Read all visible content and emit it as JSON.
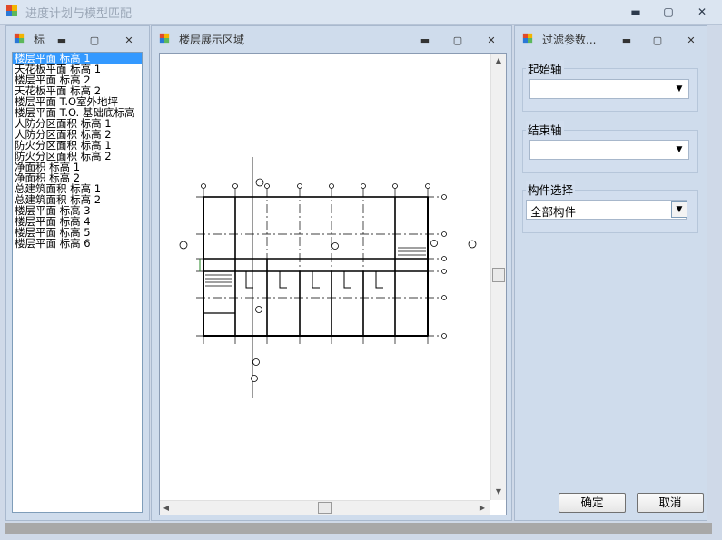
{
  "window": {
    "title": "进度计划与模型匹配",
    "min": "▬",
    "max": "▢",
    "close": "✕"
  },
  "left_panel": {
    "title": "标",
    "items": [
      "楼层平面 标高 1",
      "天花板平面 标高 1",
      "楼层平面 标高 2",
      "天花板平面 标高 2",
      "楼层平面 T.O室外地坪",
      "楼层平面 T.O. 基础底标高",
      "人防分区面积 标高 1",
      "人防分区面积 标高 2",
      "防火分区面积 标高 1",
      "防火分区面积 标高 2",
      "净面积 标高 1",
      "净面积 标高 2",
      "总建筑面积 标高 1",
      "总建筑面积 标高 2",
      "楼层平面 标高 3",
      "楼层平面 标高 4",
      "楼层平面 标高 5",
      "楼层平面 标高 6"
    ],
    "selected_index": 0
  },
  "center_panel": {
    "title": "楼层展示区域"
  },
  "right_panel": {
    "title": "过滤参数...",
    "start_axis": {
      "label": "起始轴",
      "value": ""
    },
    "end_axis": {
      "label": "结束轴",
      "value": ""
    },
    "component": {
      "label": "构件选择",
      "value": "全部构件"
    },
    "ok_label": "确定",
    "cancel_label": "取消"
  },
  "colors": {
    "accent": "#3399ff",
    "panel": "#cfdcec"
  }
}
